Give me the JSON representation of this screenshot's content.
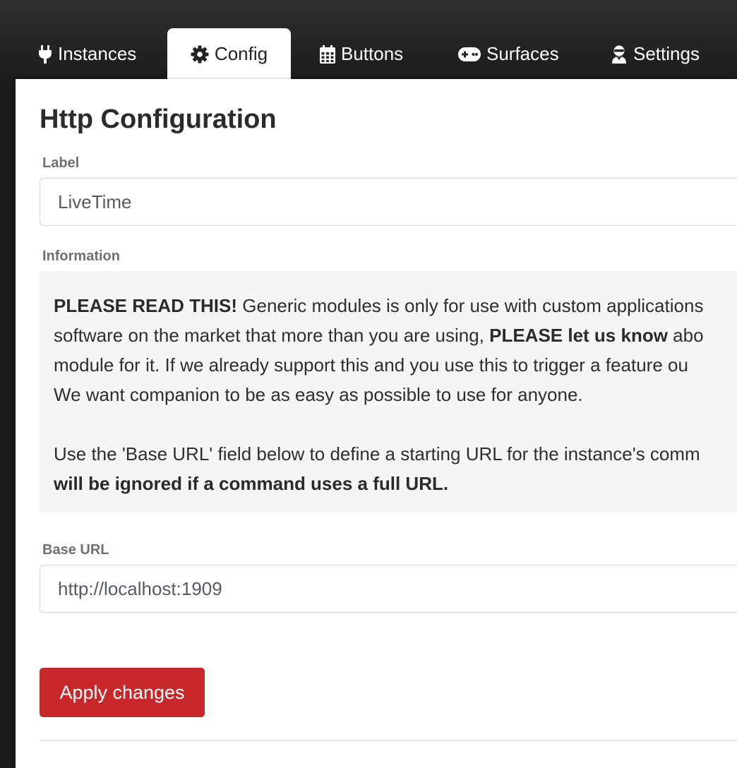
{
  "tabs": {
    "instances": {
      "label": "Instances",
      "icon": "plug-icon"
    },
    "config": {
      "label": "Config",
      "icon": "gear-icon"
    },
    "buttons": {
      "label": "Buttons",
      "icon": "calendar-grid-icon"
    },
    "surfaces": {
      "label": "Surfaces",
      "icon": "gamepad-icon"
    },
    "settings": {
      "label": "Settings",
      "icon": "user-ninja-icon"
    },
    "active": "config"
  },
  "page": {
    "title": "Http Configuration"
  },
  "fields": {
    "label": {
      "title": "Label",
      "value": "LiveTime"
    },
    "information": {
      "title": "Information"
    },
    "base_url": {
      "title": "Base URL",
      "value": "http://localhost:1909"
    }
  },
  "info": {
    "line1_bold": "PLEASE READ THIS!",
    "line1_rest": " Generic modules is only for use with custom applications",
    "line2_start": "software on the market that more than you are using, ",
    "line2_bold": "PLEASE let us know",
    "line2_end": " abo",
    "line3": "module for it. If we already support this and you use this to trigger a feature ou",
    "line4": "We want companion to be as easy as possible to use for anyone.",
    "line5": "Use the 'Base URL' field below to define a starting URL for the instance's comm",
    "line6_bold": "will be ignored if a command uses a full URL."
  },
  "actions": {
    "apply_label": "Apply changes"
  },
  "colors": {
    "accent": "#c8282a",
    "header_bg": "#2f2f2f",
    "panel_bg": "#ffffff",
    "info_bg": "#f5f5f5"
  }
}
